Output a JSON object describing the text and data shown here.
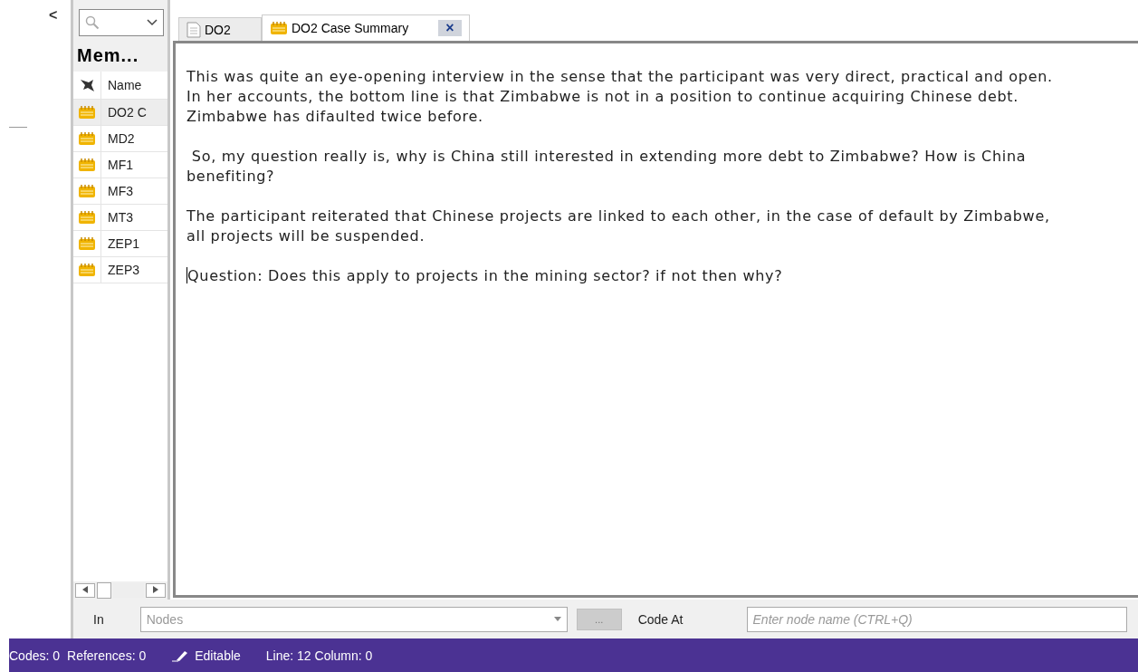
{
  "collapse_arrow": "<",
  "sidebar": {
    "title": "Mem...",
    "columns": [
      "Name"
    ],
    "items": [
      {
        "name": "DO2 C",
        "selected": true
      },
      {
        "name": "MD2",
        "selected": false
      },
      {
        "name": "MF1",
        "selected": false
      },
      {
        "name": "MF3",
        "selected": false
      },
      {
        "name": "MT3",
        "selected": false
      },
      {
        "name": "ZEP1",
        "selected": false
      },
      {
        "name": "ZEP3",
        "selected": false
      }
    ]
  },
  "tabs": [
    {
      "label": "DO2",
      "kind": "document",
      "selected": false
    },
    {
      "label": "DO2 Case Summary",
      "kind": "memo",
      "selected": true
    }
  ],
  "close_tab": "×",
  "editor": {
    "paragraphs": [
      "This was quite an eye-opening interview in the sense that the participant was very direct, practical and open. In her accounts, the bottom line is that Zimbabwe is not in a position to continue acquiring Chinese debt. Zimbabwe has difaulted twice before.",
      " So, my question really is, why is China still interested in extending more debt to Zimbabwe? How is China benefiting?",
      "The participant reiterated that Chinese projects are linked to each other, in the case of default by Zimbabwe, all projects will be suspended.",
      "Question: Does this apply to projects in the mining sector? if not then why?"
    ]
  },
  "coding_bar": {
    "in_label": "In",
    "nodes_placeholder": "Nodes",
    "browse_button": "...",
    "code_at_label": "Code At",
    "node_placeholder": "Enter node name (CTRL+Q)"
  },
  "status_bar": {
    "codes": "Codes: 0",
    "references": "References: 0",
    "mode": "Editable",
    "position": "Line: 12 Column: 0"
  }
}
